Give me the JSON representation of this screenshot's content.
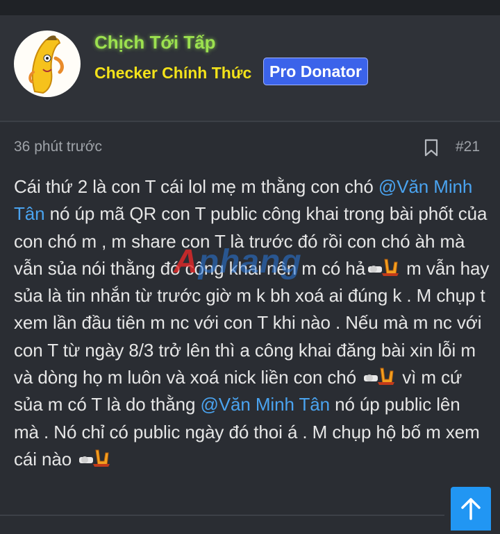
{
  "user": {
    "name": "Chịch Tới Tấp",
    "role": "Checker Chính Thức",
    "badge": "Pro Donator"
  },
  "post": {
    "time": "36 phút trước",
    "number": "#21",
    "segments": {
      "s1": "Cái thứ 2 là con T cái lol mẹ m thằng con chó ",
      "mention1": "@Văn Minh Tân",
      "s2": " nó úp mã QR con T public công khai trong bài phốt của con chó m , m share con T là trước đó rồi con chó àh mà vẫn sủa nói thằng đó công khai nên m có hả",
      "s3": " m vẫn hay sủa là tin nhắn từ trước giờ m k bh xoá ai đúng k . M chụp t xem lần đầu tiên m nc với con T khi nào . Nếu mà m nc với con T từ ngày 8/3 trở lên thì a công khai đăng bài xin lỗi m và dòng họ m luôn và xoá nick liền con chó ",
      "s4": " vì m cứ sủa m có T là do thằng ",
      "mention2": "@Văn Minh Tân",
      "s5": " nó úp public lên mà . Nó chỉ có public ngày đó thoi á . M chụp hộ bố m xem cái nào"
    }
  },
  "watermark": {
    "first": "A",
    "rest": "phang"
  },
  "icons": {
    "bookmark": "bookmark-icon",
    "scroll_top": "arrow-up-icon",
    "emoji": "emoji-sticker-icon",
    "avatar": "banana-avatar"
  },
  "colors": {
    "username": "#9ce14f",
    "role": "#f3e21a",
    "badge_bg": "#3b63ea",
    "mention": "#4aa3ef",
    "scroll_button": "#2196f3"
  }
}
